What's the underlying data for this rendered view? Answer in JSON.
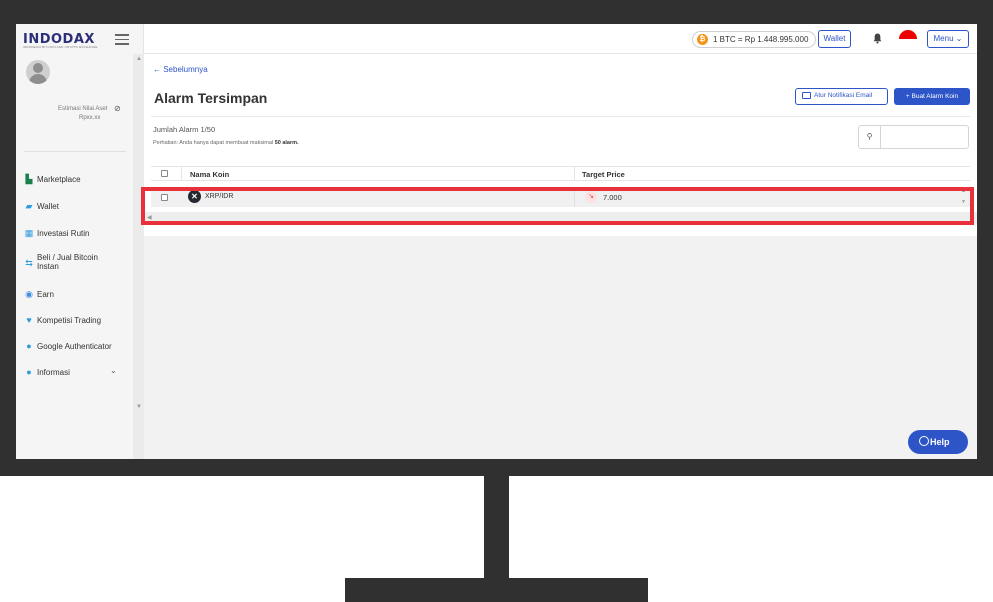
{
  "header": {
    "logo": "INDODAX",
    "logo_sub": "INDONESIA BITCOIN AND CRYPTO EXCHANGE",
    "btc_price": "1 BTC = Rp 1.448.995.000",
    "wallet_label": "Wallet",
    "menu_label": "Menu"
  },
  "sidebar": {
    "asset_label": "Estimasi Nilai Aset",
    "asset_value": "Rpxx.xx",
    "items": [
      {
        "label": "Marketplace",
        "icon": "chart-icon"
      },
      {
        "label": "Wallet",
        "icon": "wallet-icon"
      },
      {
        "label": "Investasi Rutin",
        "icon": "calendar-icon"
      },
      {
        "label": "Beli / Jual Bitcoin Instan",
        "icon": "exchange-icon"
      },
      {
        "label": "Earn",
        "icon": "earn-icon"
      },
      {
        "label": "Kompetisi Trading",
        "icon": "trophy-icon"
      },
      {
        "label": "Google Authenticator",
        "icon": "authenticator-icon"
      },
      {
        "label": "Informasi",
        "icon": "info-icon"
      }
    ]
  },
  "main": {
    "back_link": "← Sebelumnya",
    "title": "Alarm Tersimpan",
    "email_button": "Atur Notifikasi Email",
    "create_button": "+ Buat Alarm Koin",
    "count_label": "Jumlah Alarm 1/50",
    "notice_prefix": "Perhatian: Anda hanya dapat membuat maksimal",
    "notice_bold": "50 alarm.",
    "search_placeholder": "",
    "columns": [
      "Nama Koin",
      "Target Price"
    ],
    "rows": [
      {
        "coin": "XRP/IDR",
        "target_price": "7.000",
        "direction": "down"
      }
    ]
  },
  "help_label": "Help",
  "colors": {
    "accent": "#2d55c8",
    "highlight": "#e8313b",
    "bezel": "#303030"
  }
}
